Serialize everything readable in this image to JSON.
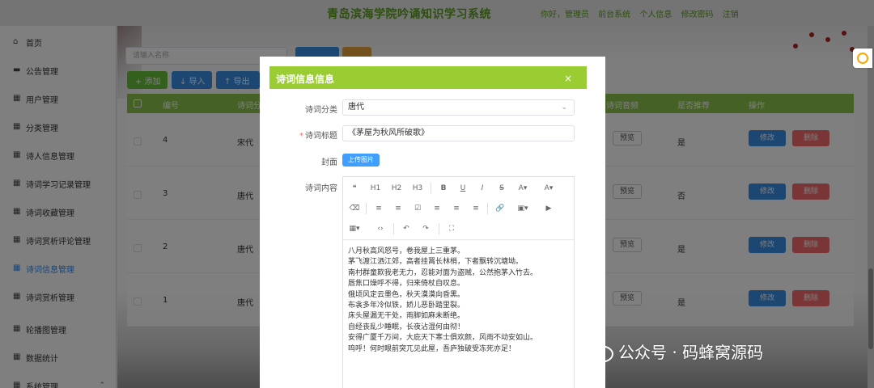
{
  "header": {
    "title": "青岛滨海学院吟诵知识学习系统",
    "links": [
      "你好，管理员",
      "前台系统",
      "个人信息",
      "修改密码",
      "注销"
    ]
  },
  "sidebar": {
    "items": [
      {
        "label": "首页",
        "icon": "home-icon"
      },
      {
        "label": "公告管理",
        "icon": "notice-icon"
      },
      {
        "label": "用户管理",
        "icon": "grid-icon"
      },
      {
        "label": "分类管理",
        "icon": "grid-icon"
      },
      {
        "label": "诗人信息管理",
        "icon": "grid-icon"
      },
      {
        "label": "诗词学习记录管理",
        "icon": "grid-icon"
      },
      {
        "label": "诗词收藏管理",
        "icon": "grid-icon"
      },
      {
        "label": "诗词赏析评论管理",
        "icon": "grid-icon"
      },
      {
        "label": "诗词信息管理",
        "icon": "grid-icon",
        "active": true
      },
      {
        "label": "诗词赏析管理",
        "icon": "grid-icon"
      },
      {
        "label": "轮播图管理",
        "icon": "grid-icon"
      },
      {
        "label": "数据统计",
        "icon": "grid-icon"
      },
      {
        "label": "系统管理",
        "icon": "grid-icon"
      }
    ]
  },
  "main": {
    "search_placeholder": "请输入名称",
    "toolbar": {
      "add": "+ 添加",
      "import": "↓ 导入",
      "export": "↑ 导出"
    },
    "columns": {
      "no": "编号",
      "category": "诗词分",
      "preview": "诗词音频",
      "recommend": "是否推荐",
      "actions": "操作"
    },
    "rows": [
      {
        "no": "4",
        "category": "宋代",
        "preview": "预览",
        "recommend": "是",
        "edit": "修改",
        "delete": "删除"
      },
      {
        "no": "3",
        "category": "唐代",
        "preview": "预览",
        "recommend": "否",
        "edit": "修改",
        "delete": "删除"
      },
      {
        "no": "2",
        "category": "唐代",
        "preview": "预览",
        "recommend": "是",
        "edit": "修改",
        "delete": "删除"
      },
      {
        "no": "1",
        "category": "唐代",
        "preview": "预览",
        "recommend": "是",
        "edit": "修改",
        "delete": "删除"
      }
    ]
  },
  "dialog": {
    "title": "诗词信息信息",
    "close": "×",
    "category_label": "诗词分类",
    "category_value": "唐代",
    "title_label": "诗词标题",
    "title_value": "《茅屋为秋风所破歌》",
    "cover_label": "封面",
    "upload_label": "上传图片",
    "content_label": "诗词内容",
    "content_lines": [
      "八月秋高风怒号，卷我屋上三重茅。",
      "茅飞渡江洒江郊，高者挂罥长林梢，下者飘转沉塘坳。",
      "南村群童欺我老无力，忍能对面为盗贼，公然抱茅入竹去。",
      "唇焦口燥呼不得，归来倚杖自叹息。",
      "俄顷风定云墨色，秋天漠漠向昏黑。",
      "布衾多年冷似铁，娇儿恶卧踏里裂。",
      "床头屋漏无干处，雨脚如麻未断绝。",
      "自经丧乱少睡眠，长夜沾湿何由彻！",
      "安得广厦千万间，大庇天下寒士俱欢颜，风雨不动安如山。",
      "呜呼！何时眼前突兀见此屋，吾庐独破受冻死亦足！"
    ],
    "editor_toolbar": {
      "row1": [
        "❝",
        "H1",
        "H2",
        "H3",
        "B",
        "U",
        "I",
        "S",
        "A▾",
        "A▾"
      ],
      "row2": [
        "⌫",
        "≡",
        "≡",
        "☑",
        "≡",
        "≡",
        "≡",
        "🔗",
        "▣▾",
        "▶"
      ],
      "row3": [
        "▦▾",
        "‹›",
        "↶",
        "↷",
        "⛶"
      ]
    }
  },
  "watermark": "公众号 · 码蜂窝源码"
}
